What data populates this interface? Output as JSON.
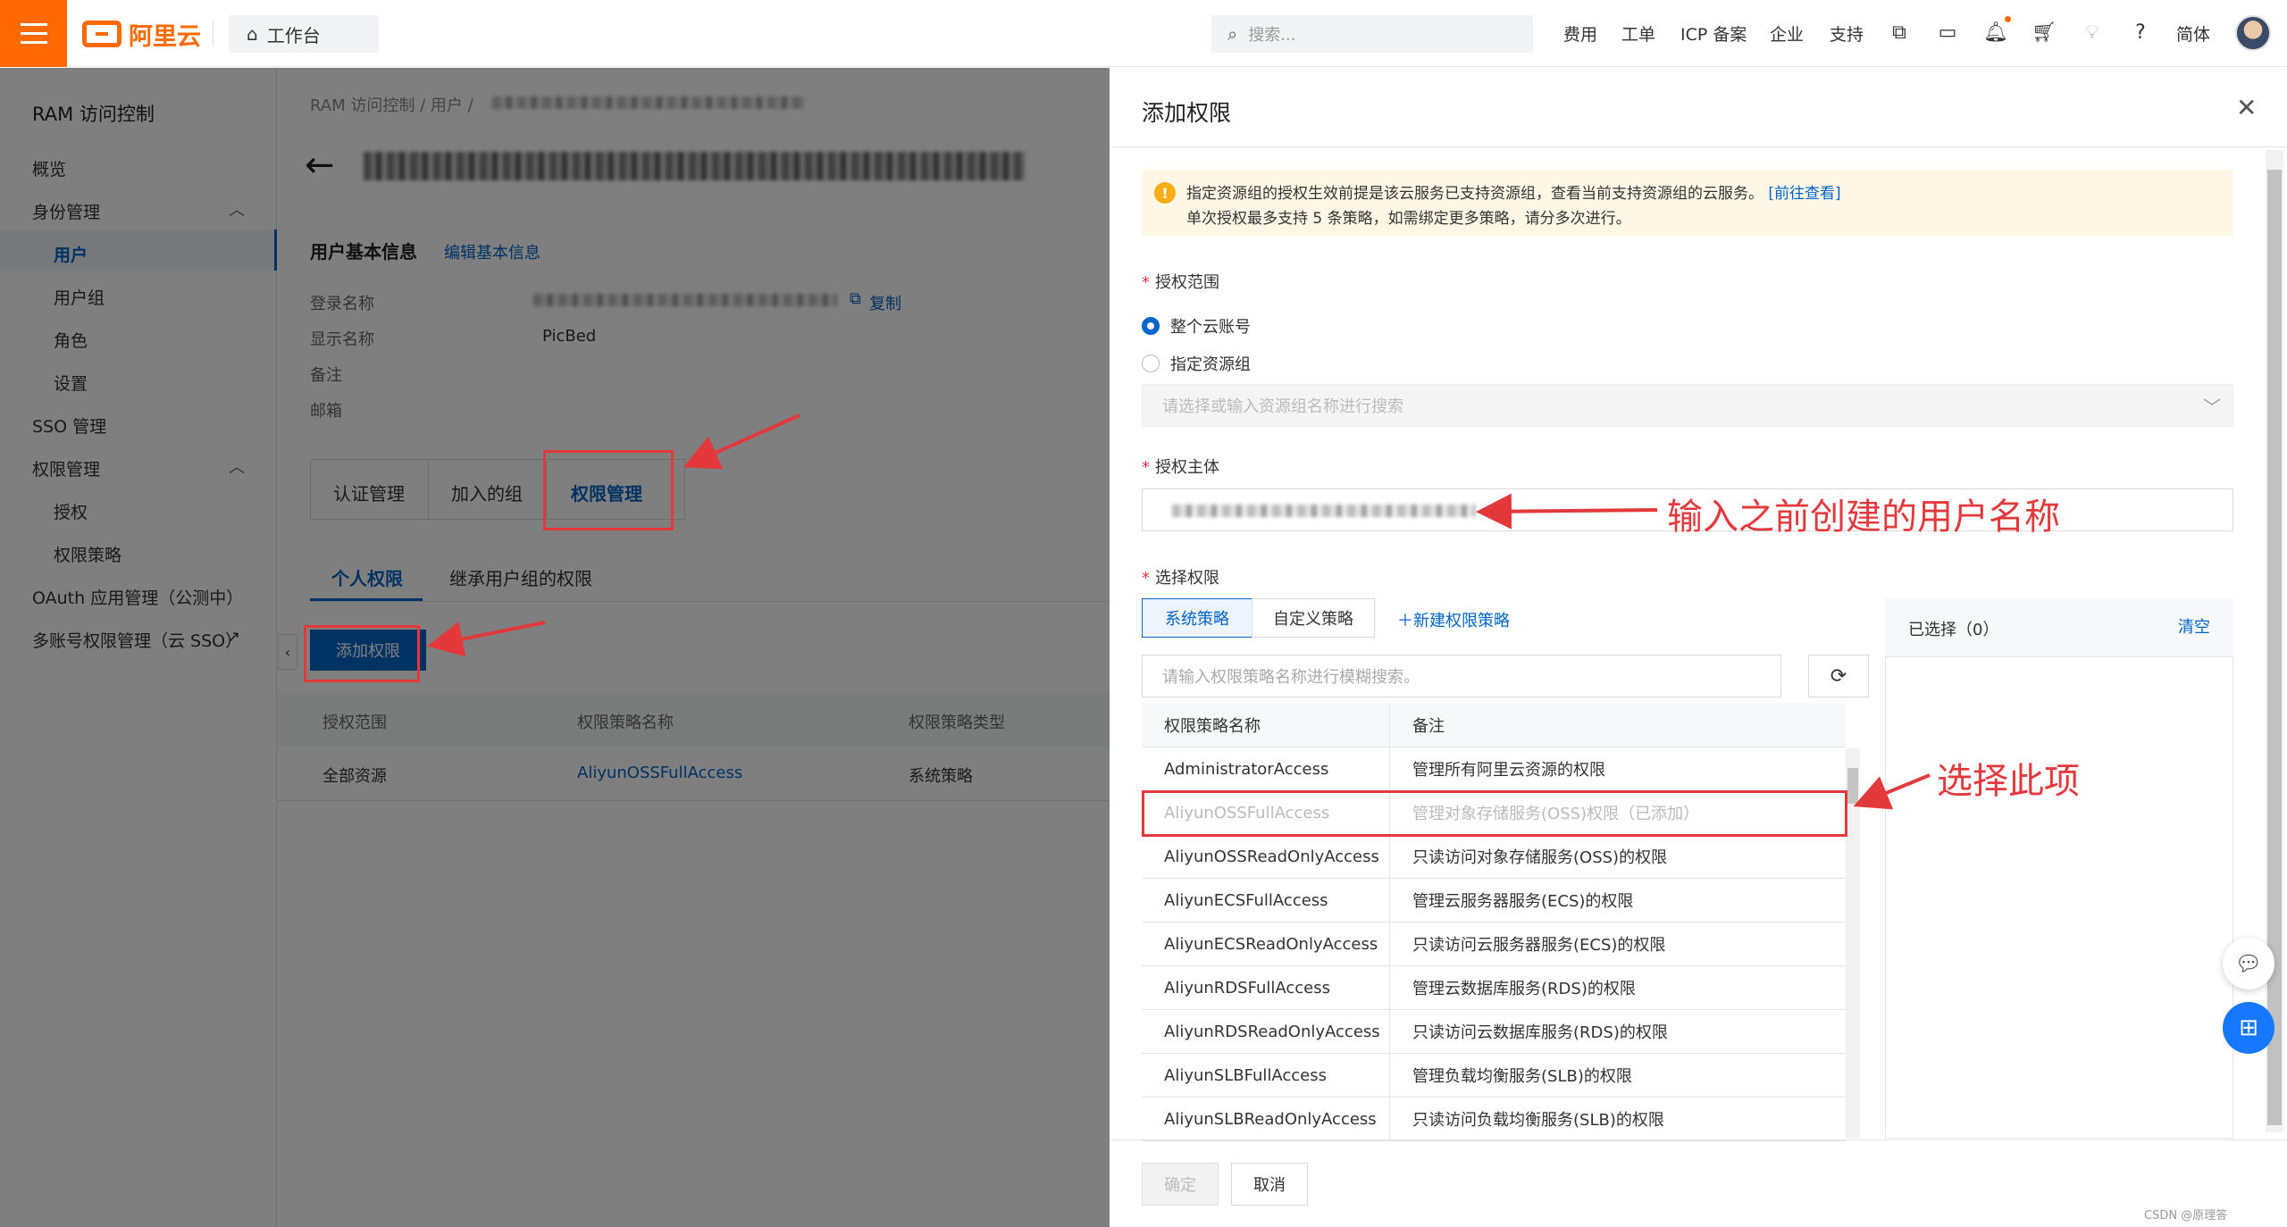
{
  "topbar": {
    "logo_text": "阿里云",
    "workbench_label": "工作台",
    "search_placeholder": "搜索...",
    "nav": [
      "费用",
      "工单",
      "ICP 备案",
      "企业",
      "支持",
      "简体"
    ]
  },
  "sidebar": {
    "title": "RAM 访问控制",
    "items": [
      {
        "label": "概览",
        "level": 0
      },
      {
        "label": "身份管理",
        "level": 0,
        "expanded": true
      },
      {
        "label": "用户",
        "level": 1,
        "active": true
      },
      {
        "label": "用户组",
        "level": 1
      },
      {
        "label": "角色",
        "level": 1
      },
      {
        "label": "设置",
        "level": 1
      },
      {
        "label": "SSO 管理",
        "level": 0
      },
      {
        "label": "权限管理",
        "level": 0,
        "expanded": true
      },
      {
        "label": "授权",
        "level": 1
      },
      {
        "label": "权限策略",
        "level": 1
      },
      {
        "label": "OAuth 应用管理（公测中）",
        "level": 0
      },
      {
        "label": "多账号权限管理（云 SSO）",
        "level": 0,
        "external": true
      }
    ]
  },
  "page": {
    "breadcrumb": [
      "RAM 访问控制",
      "用户"
    ],
    "section_title": "用户基本信息",
    "edit_link": "编辑基本信息",
    "fields": {
      "login_name_label": "登录名称",
      "display_name_label": "显示名称",
      "display_name_value": "PicBed",
      "note_label": "备注",
      "email_label": "邮箱",
      "copy_label": "复制"
    },
    "tabs": [
      "认证管理",
      "加入的组",
      "权限管理"
    ],
    "subtabs": [
      "个人权限",
      "继承用户组的权限"
    ],
    "add_permission_button": "添加权限",
    "table": {
      "headers": [
        "授权范围",
        "权限策略名称",
        "权限策略类型"
      ],
      "rows": [
        [
          "全部资源",
          "AliyunOSSFullAccess",
          "系统策略"
        ]
      ]
    }
  },
  "drawer": {
    "title": "添加权限",
    "notice_line1": "指定资源组的授权生效前提是该云服务已支持资源组，查看当前支持资源组的云服务。",
    "notice_link": "[前往查看]",
    "notice_line2": "单次授权最多支持 5 条策略，如需绑定更多策略，请分多次进行。",
    "scope_label": "授权范围",
    "scope_options": [
      {
        "label": "整个云账号",
        "selected": true
      },
      {
        "label": "指定资源组",
        "selected": false
      }
    ],
    "resource_group_placeholder": "请选择或输入资源组名称进行搜索",
    "principal_label": "授权主体",
    "policy_label": "选择权限",
    "policy_tabs": [
      "系统策略",
      "自定义策略"
    ],
    "new_policy_link": "新建权限策略",
    "policy_search_placeholder": "请输入权限策略名称进行模糊搜索。",
    "table_headers": [
      "权限策略名称",
      "备注"
    ],
    "policies": [
      {
        "name": "AdministratorAccess",
        "note": "管理所有阿里云资源的权限",
        "disabled": false
      },
      {
        "name": "AliyunOSSFullAccess",
        "note": "管理对象存储服务(OSS)权限（已添加）",
        "disabled": true
      },
      {
        "name": "AliyunOSSReadOnlyAccess",
        "note": "只读访问对象存储服务(OSS)的权限",
        "disabled": false
      },
      {
        "name": "AliyunECSFullAccess",
        "note": "管理云服务器服务(ECS)的权限",
        "disabled": false
      },
      {
        "name": "AliyunECSReadOnlyAccess",
        "note": "只读访问云服务器服务(ECS)的权限",
        "disabled": false
      },
      {
        "name": "AliyunRDSFullAccess",
        "note": "管理云数据库服务(RDS)的权限",
        "disabled": false
      },
      {
        "name": "AliyunRDSReadOnlyAccess",
        "note": "只读访问云数据库服务(RDS)的权限",
        "disabled": false
      },
      {
        "name": "AliyunSLBFullAccess",
        "note": "管理负载均衡服务(SLB)的权限",
        "disabled": false
      },
      {
        "name": "AliyunSLBReadOnlyAccess",
        "note": "只读访问负载均衡服务(SLB)的权限",
        "disabled": false
      }
    ],
    "selected_title": "已选择（0）",
    "clear_label": "清空",
    "confirm_label": "确定",
    "cancel_label": "取消"
  },
  "annotations": {
    "principal_hint": "输入之前创建的用户名称",
    "select_hint": "选择此项"
  },
  "watermark": "CSDN @原理答",
  "colors": {
    "brand": "#ff6a00",
    "primary": "#0064c8",
    "annotation": "#e4393c"
  }
}
